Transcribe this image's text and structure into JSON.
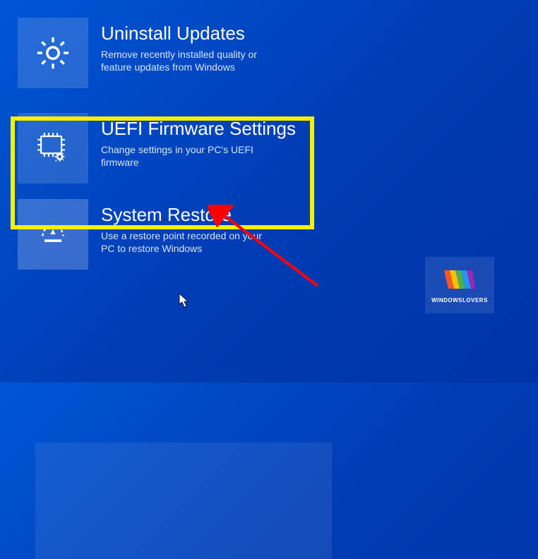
{
  "options": [
    {
      "title": "Uninstall Updates",
      "desc": "Remove recently installed quality or feature updates from Windows"
    },
    {
      "title": "UEFI Firmware Settings",
      "desc": "Change settings in your PC's UEFI firmware"
    },
    {
      "title": "System Restore",
      "desc": "Use a restore point recorded on your PC to restore Windows"
    }
  ],
  "logo": {
    "text": "WINDOWSLOVERS"
  }
}
